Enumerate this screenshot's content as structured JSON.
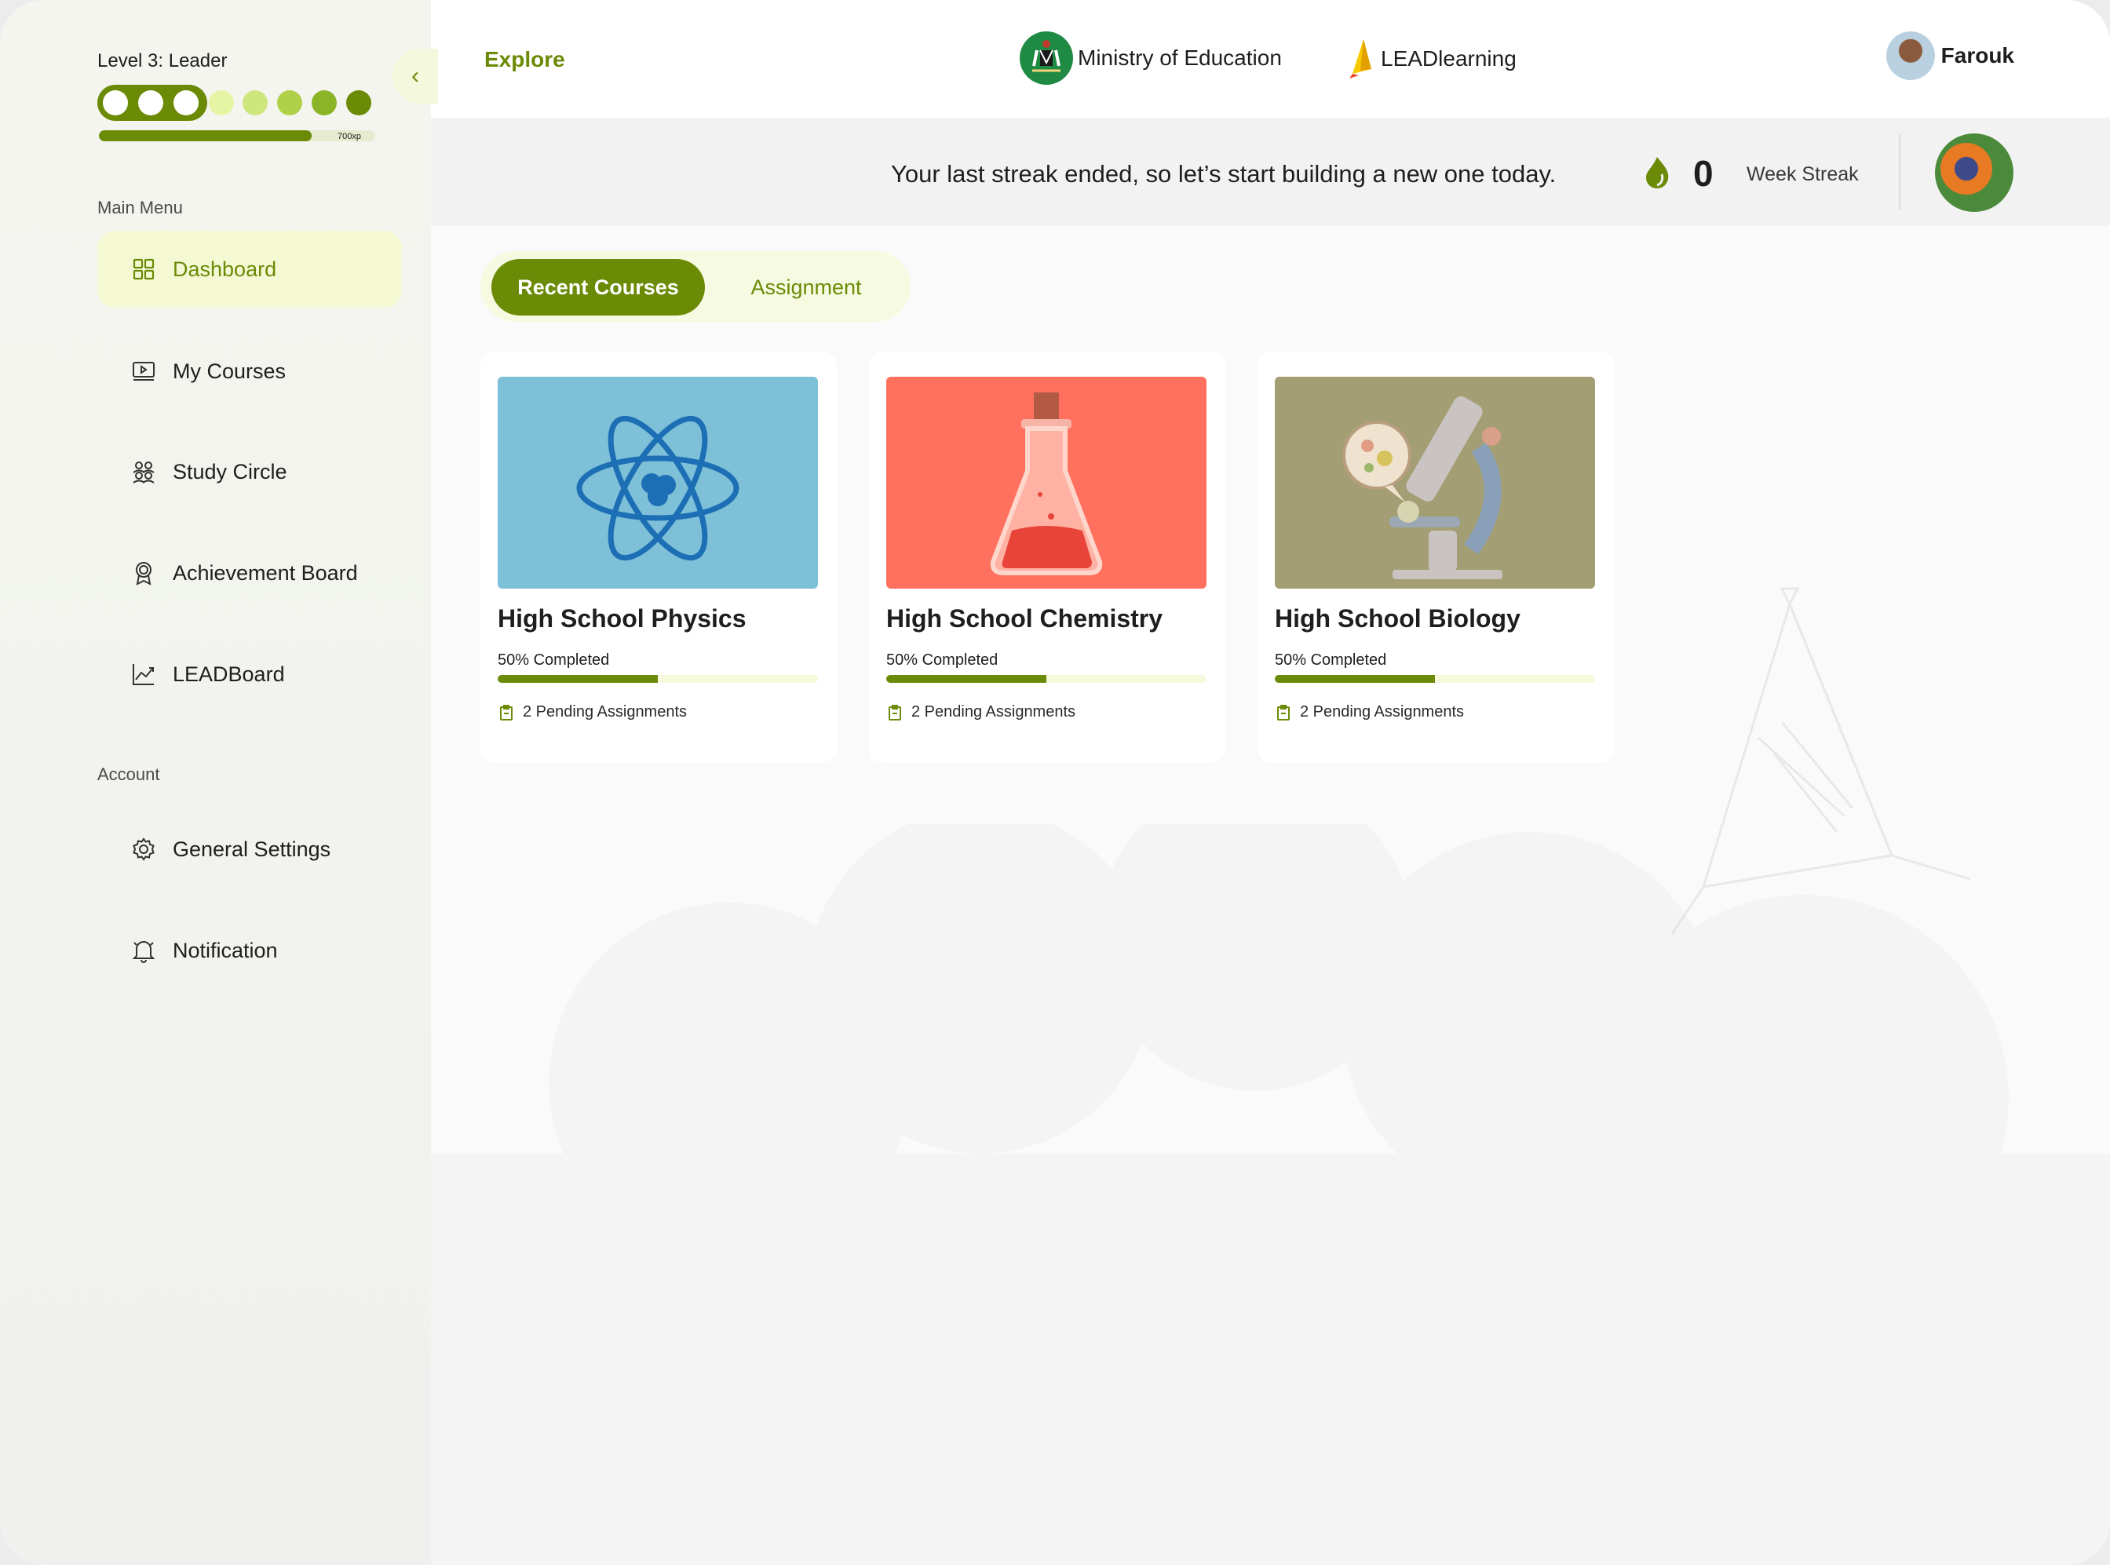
{
  "sidebar": {
    "level_label": "Level 3: Leader",
    "xp_label": "700xp",
    "xp_progress": 0.77,
    "level_dots": [
      "#ffffff",
      "#ffffff",
      "#ffffff",
      "#e6f5a4",
      "#cfe57e",
      "#b0d04a",
      "#8cb427",
      "#6b8a06"
    ],
    "main_menu_title": "Main Menu",
    "main_menu": [
      {
        "label": "Dashboard",
        "icon": "grid-icon",
        "active": true
      },
      {
        "label": "My Courses",
        "icon": "video-screen-icon",
        "active": false
      },
      {
        "label": "Study Circle",
        "icon": "group-icon",
        "active": false
      },
      {
        "label": "Achievement Board",
        "icon": "award-icon",
        "active": false
      },
      {
        "label": "LEADBoard",
        "icon": "chart-line-icon",
        "active": false
      }
    ],
    "account_title": "Account",
    "account_menu": [
      {
        "label": "General  Settings",
        "icon": "gear-icon"
      },
      {
        "label": "Notification",
        "icon": "bell-icon"
      }
    ]
  },
  "header": {
    "explore": "Explore",
    "ministry": "Ministry of Education",
    "brand": "LEADlearning",
    "user_name": "Farouk"
  },
  "streak": {
    "message": "Your last streak ended, so let’s start building a new one today.",
    "count": "0",
    "label": "Week Streak"
  },
  "tabs": [
    {
      "label": "Recent Courses",
      "active": true
    },
    {
      "label": "Assignment",
      "active": false
    }
  ],
  "courses": [
    {
      "title": "High School Physics",
      "progress_label": "50% Completed",
      "progress": 0.5,
      "pending": "2 Pending Assignments",
      "image_color": "#7ec0d8",
      "image_icon": "atom-icon"
    },
    {
      "title": "High School Chemistry",
      "progress_label": "50% Completed",
      "progress": 0.5,
      "pending": "2 Pending Assignments",
      "image_color": "#ff705e",
      "image_icon": "flask-icon"
    },
    {
      "title": "High School Biology",
      "progress_label": "50% Completed",
      "progress": 0.5,
      "pending": "2 Pending Assignments",
      "image_color": "#a39e73",
      "image_icon": "microscope-icon"
    }
  ],
  "colors": {
    "accent": "#6b8a06",
    "accent_light": "#f4f9d4"
  }
}
